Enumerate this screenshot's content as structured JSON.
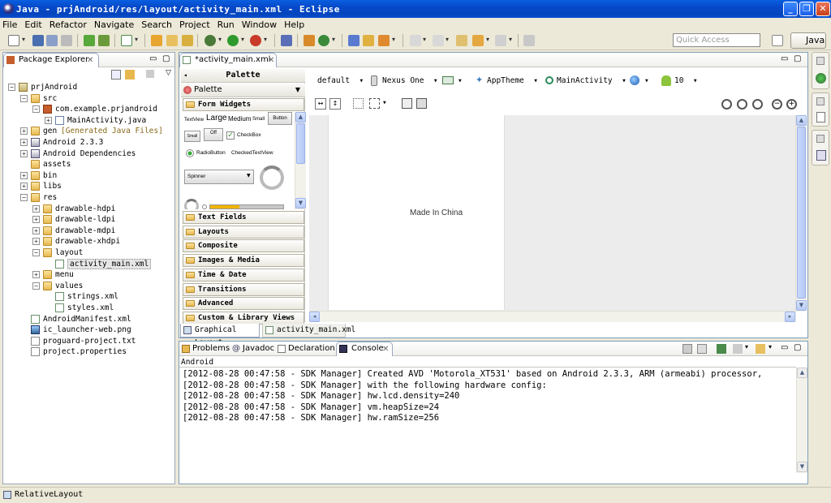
{
  "window": {
    "title": "Java - prjAndroid/res/layout/activity_main.xml - Eclipse"
  },
  "menu": [
    "File",
    "Edit",
    "Refactor",
    "Navigate",
    "Search",
    "Project",
    "Run",
    "Window",
    "Help"
  ],
  "toolbar": {
    "quick_access_placeholder": "Quick Access",
    "perspective": "Java"
  },
  "package_explorer": {
    "title": "Package Explorer",
    "tree": [
      {
        "label": "prjAndroid",
        "depth": 0,
        "icon": "project-icon",
        "exp": "-"
      },
      {
        "label": "src",
        "depth": 1,
        "icon": "source-folder-icon",
        "exp": "-"
      },
      {
        "label": "com.example.prjandroid",
        "depth": 2,
        "icon": "package-icon",
        "exp": "-"
      },
      {
        "label": "MainActivity.java",
        "depth": 3,
        "icon": "java-file-icon",
        "exp": "+"
      },
      {
        "label": "gen",
        "depth": 1,
        "icon": "folder-icon",
        "exp": "+",
        "suffix": "[Generated Java Files]"
      },
      {
        "label": "Android 2.3.3",
        "depth": 1,
        "icon": "library-icon",
        "exp": "+"
      },
      {
        "label": "Android Dependencies",
        "depth": 1,
        "icon": "library-icon",
        "exp": "+"
      },
      {
        "label": "assets",
        "depth": 1,
        "icon": "folder-icon",
        "exp": ""
      },
      {
        "label": "bin",
        "depth": 1,
        "icon": "folder-icon",
        "exp": "+"
      },
      {
        "label": "libs",
        "depth": 1,
        "icon": "folder-icon",
        "exp": "+"
      },
      {
        "label": "res",
        "depth": 1,
        "icon": "folder-icon",
        "exp": "-"
      },
      {
        "label": "drawable-hdpi",
        "depth": 2,
        "icon": "folder-icon",
        "exp": "+"
      },
      {
        "label": "drawable-ldpi",
        "depth": 2,
        "icon": "folder-icon",
        "exp": "+"
      },
      {
        "label": "drawable-mdpi",
        "depth": 2,
        "icon": "folder-icon",
        "exp": "+"
      },
      {
        "label": "drawable-xhdpi",
        "depth": 2,
        "icon": "folder-icon",
        "exp": "+"
      },
      {
        "label": "layout",
        "depth": 2,
        "icon": "folder-icon",
        "exp": "-"
      },
      {
        "label": "activity_main.xml",
        "depth": 3,
        "icon": "xml-file-icon",
        "exp": "",
        "selected": true
      },
      {
        "label": "menu",
        "depth": 2,
        "icon": "folder-icon",
        "exp": "+"
      },
      {
        "label": "values",
        "depth": 2,
        "icon": "folder-icon",
        "exp": "-"
      },
      {
        "label": "strings.xml",
        "depth": 3,
        "icon": "xml-file-icon",
        "exp": ""
      },
      {
        "label": "styles.xml",
        "depth": 3,
        "icon": "xml-file-icon",
        "exp": ""
      },
      {
        "label": "AndroidManifest.xml",
        "depth": 1,
        "icon": "xml-file-icon",
        "exp": ""
      },
      {
        "label": "ic_launcher-web.png",
        "depth": 1,
        "icon": "image-file-icon",
        "exp": ""
      },
      {
        "label": "proguard-project.txt",
        "depth": 1,
        "icon": "text-file-icon",
        "exp": ""
      },
      {
        "label": "project.properties",
        "depth": 1,
        "icon": "text-file-icon",
        "exp": ""
      }
    ]
  },
  "editor": {
    "tab_label": "*activity_main.xml",
    "palette_header": "Palette",
    "palette_title": "Palette",
    "form_widgets_label": "Form Widgets",
    "widgets": {
      "textview": "TextView",
      "large": "Large",
      "medium": "Medium",
      "small": "Small",
      "button": "Button",
      "small_button": "Small",
      "toggle": "Off",
      "checkbox": "CheckBox",
      "radio": "RadioButton",
      "checked_textview": "CheckedTextView",
      "spinner": "Spinner"
    },
    "categories": [
      "Text Fields",
      "Layouts",
      "Composite",
      "Images & Media",
      "Time & Date",
      "Transitions",
      "Advanced",
      "Custom & Library Views"
    ],
    "config": {
      "layout": "default",
      "device": "Nexus One",
      "theme": "AppTheme",
      "activity": "MainActivity",
      "api": "10"
    },
    "canvas_text": "Made In China",
    "bottom_tabs": [
      "Graphical Layout",
      "activity_main.xml"
    ]
  },
  "console": {
    "tabs": [
      "Problems",
      "Javadoc",
      "Declaration",
      "Console"
    ],
    "subtitle": "Android",
    "lines": [
      "[2012-08-28 00:47:58 - SDK Manager] Created AVD 'Motorola_XT531' based on Android 2.3.3, ARM (armeabi) processor,",
      "[2012-08-28 00:47:58 - SDK Manager] with the following hardware config:",
      "[2012-08-28 00:47:58 - SDK Manager] hw.lcd.density=240",
      "[2012-08-28 00:47:58 - SDK Manager] vm.heapSize=24",
      "[2012-08-28 00:47:58 - SDK Manager] hw.ramSize=256"
    ]
  },
  "status": {
    "text": "RelativeLayout"
  }
}
